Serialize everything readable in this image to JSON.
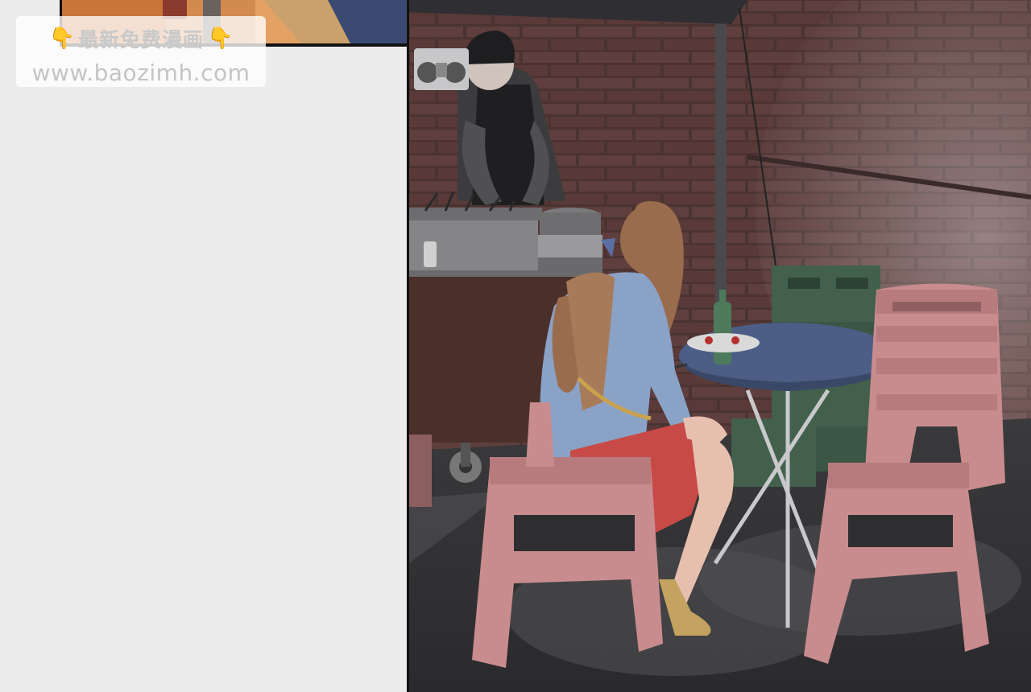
{
  "watermark": {
    "title": "最新免费漫画",
    "url": "www.baozimh.com",
    "left_icon": "pointing-down-hand-icon",
    "right_icon": "pointing-down-hand-icon",
    "hand_glyph": "👇"
  },
  "colors": {
    "page_background": "#ececec",
    "brick": "#6e4a47",
    "table_top": "#4c5d86",
    "stool": "#c98c8e",
    "crate": "#42604c",
    "skirt": "#c84a46",
    "cardigan": "#8aa2c6",
    "hair": "#9a6c4e"
  }
}
